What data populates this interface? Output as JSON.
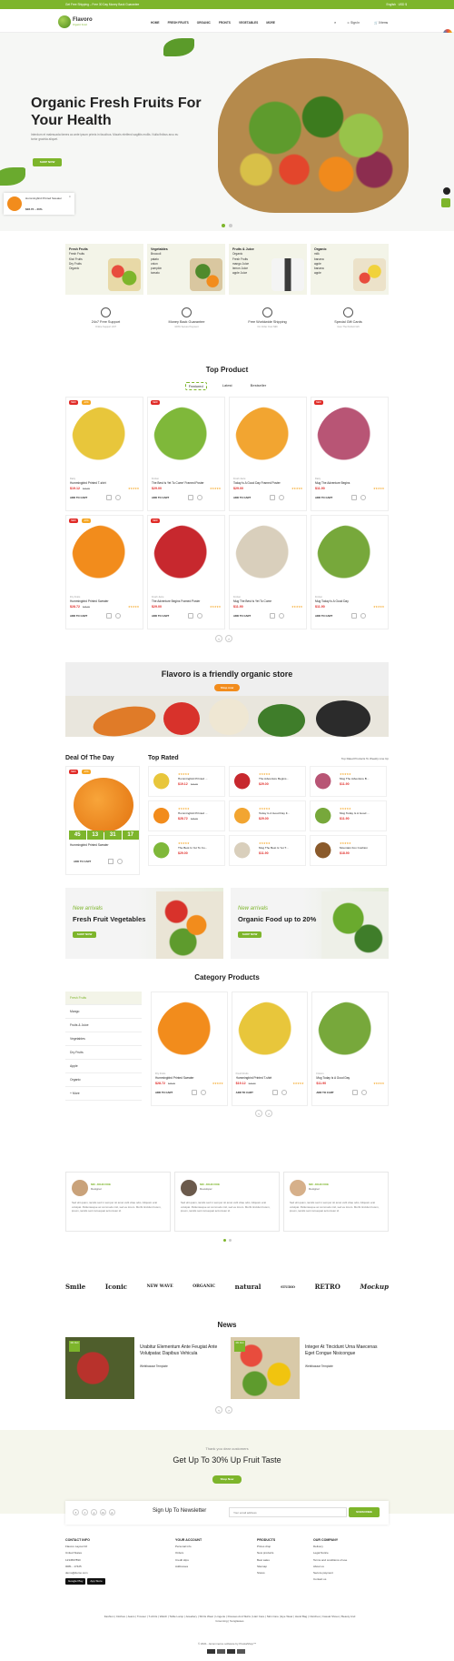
{
  "topbar": {
    "message": "Get Free Shipping – Free 30 Day Money Back Guarantee",
    "language": "English",
    "currency": "USD $"
  },
  "header": {
    "logo": "Flavoro",
    "tagline": "Organic Food",
    "nav": [
      "HOME",
      "FRESH FRUITS",
      "ORGANIC",
      "FRONTS",
      "VEGETABLES",
      "MORE"
    ],
    "signin": "Sign In",
    "cart": "0 items"
  },
  "hero": {
    "title": "Organic Fresh Fruits For Your Health",
    "subtitle": "Interdum et malesuada fames ac ante ipsum primis in faucibus. Mauris eleifend sagittis mollis. Nulla finibus arcu eu tortor gravida aliquet.",
    "button": "SHOP NOW"
  },
  "popup": {
    "name": "Hummingbird Printed Sweater",
    "price": "$28.72 – 20%"
  },
  "categories": [
    {
      "title": "Fresh Fruits",
      "items": [
        "Fresh Fruits",
        "Kiwi Fruits",
        "Dry Fruits",
        "Organic"
      ]
    },
    {
      "title": "Vegetables",
      "items": [
        "Broccoli",
        "patato",
        "onion",
        "pumpkin",
        "tomato"
      ]
    },
    {
      "title": "Fruits & Juice",
      "items": [
        "Organic",
        "Fresh Fruits",
        "mango Juice",
        "lemon Juice",
        "apple Juice"
      ]
    },
    {
      "title": "Organic",
      "items": [
        "milk",
        "banana",
        "apple",
        "banana",
        "apple"
      ]
    }
  ],
  "features": [
    {
      "title": "24x7 Free Support",
      "sub": "Online Support 24/7"
    },
    {
      "title": "Money Back Guarantee",
      "sub": "100% Secure Payment"
    },
    {
      "title": "Free Worldwide Shipping",
      "sub": "On Order Over $99"
    },
    {
      "title": "Special Gift Cards",
      "sub": "Give The Perfect Gift"
    }
  ],
  "top_product": {
    "title": "Top Product",
    "tabs": [
      "Featured",
      "Latest",
      "Bestseller"
    ]
  },
  "products": [
    {
      "cat": "Dairy",
      "name": "Hummingbird Printed T-shirt",
      "price": "$19.12",
      "old": "$23.90",
      "badges": [
        "NEW",
        "-20%"
      ],
      "color": "#e8c63b"
    },
    {
      "cat": "Frozen",
      "name": "The Best Is Yet To Come' Framed Poster",
      "price": "$29.00",
      "old": "",
      "badges": [
        "NEW"
      ],
      "color": "#7fb83a"
    },
    {
      "cat": "Fresh Juice",
      "name": "Today Is A Good Day Framed Poster",
      "price": "$29.00",
      "old": "",
      "badges": [],
      "color": "#f2a531"
    },
    {
      "cat": "Dairy",
      "name": "Mug The Adventure Begins",
      "price": "$11.90",
      "old": "",
      "badges": [
        "NEW"
      ],
      "color": "#b85575"
    },
    {
      "cat": "Dry Fruits",
      "name": "Hummingbird Printed Sweater",
      "price": "$28.72",
      "old": "$35.90",
      "badges": [
        "NEW",
        "-20%"
      ],
      "color": "#f28c1c"
    },
    {
      "cat": "Fresh Juice",
      "name": "The Adventure Begins Framed Poster",
      "price": "$29.00",
      "old": "",
      "badges": [
        "NEW"
      ],
      "color": "#c7282e"
    },
    {
      "cat": "Frozen",
      "name": "Mug The Best Is Yet To Come",
      "price": "$11.90",
      "old": "",
      "badges": [],
      "color": "#d9cfbc"
    },
    {
      "cat": "Frozen",
      "name": "Mug Today Is A Good Day",
      "price": "$11.90",
      "old": "",
      "badges": [],
      "color": "#77a83b"
    }
  ],
  "card_labels": {
    "add": "ADD TO CART",
    "stars": "★★★★★"
  },
  "store_banner": {
    "title": "Flavoro is a friendly organic store",
    "button": "Shop now"
  },
  "deal": {
    "title": "Deal Of The Day",
    "name": "Hummingbird Printed Sweater",
    "timer": [
      "45",
      "13",
      "31",
      "17"
    ],
    "badges": [
      "NEW",
      "-20%"
    ]
  },
  "top_rated": {
    "title": "Top Rated",
    "link": "Top Rated Products To Weekly Line Up",
    "items": [
      {
        "name": "Hummingbird Printed ...",
        "price": "$19.12",
        "old": "$23.90",
        "color": "#e8c63b"
      },
      {
        "name": "The Adventure Begins...",
        "price": "$29.00",
        "old": "",
        "color": "#c7282e"
      },
      {
        "name": "Mug The Adventure B...",
        "price": "$11.90",
        "old": "",
        "color": "#b85575"
      },
      {
        "name": "Hummingbird Printed ...",
        "price": "$28.72",
        "old": "$35.90",
        "color": "#f28c1c"
      },
      {
        "name": "Today Is A Good Day F...",
        "price": "$29.00",
        "old": "",
        "color": "#f2a531"
      },
      {
        "name": "Mug Today Is A Good ...",
        "price": "$11.90",
        "old": "",
        "color": "#77a83b"
      },
      {
        "name": "The Best Is Yet To Co...",
        "price": "$29.00",
        "old": "",
        "color": "#7fb83a"
      },
      {
        "name": "Mug The Best Is Yet T...",
        "price": "$11.90",
        "old": "",
        "color": "#d9cfbc"
      },
      {
        "name": "Mountain Fox Cushion",
        "price": "$18.90",
        "old": "",
        "color": "#8a5a2b"
      }
    ]
  },
  "promos": [
    {
      "tag": "New arrivals",
      "title": "Fresh Fruit Vegetables",
      "button": "SHOP NOW"
    },
    {
      "tag": "New arrivals",
      "title": "Organic Food up to 20%",
      "button": "SHOP NOW"
    }
  ],
  "category_products": {
    "title": "Category Products",
    "sidebar": [
      "Fresh Fruits",
      "Mango",
      "Fruits & Juice",
      "Vegetables",
      "Dry Fruits",
      "Apple",
      "Organic",
      "+ More"
    ],
    "items": [
      {
        "cat": "Dry Fruits",
        "name": "Hummingbird Printed Sweater",
        "price": "$28.72",
        "old": "$35.90",
        "color": "#f28c1c"
      },
      {
        "cat": "Fresh Fruits",
        "name": "Hummingbird Printed T-shirt",
        "price": "$19.12",
        "old": "$23.90",
        "color": "#e8c63b"
      },
      {
        "cat": "Frozen",
        "name": "Mug Today Is A Good Day",
        "price": "$11.90",
        "old": "",
        "color": "#77a83b"
      }
    ]
  },
  "testimonials": [
    {
      "name": "MR. JOHN DOE",
      "role": "Designer",
      "text": "Sed elit quam, iaculis sed in semper sit amet velit vitae odio. Aliquam erat volutpat. Pellentesque ac commodo nisl, sed eu lorem. Morbi tincidunt lorem, ipsum, iaculis sed consequat accumsan id."
    },
    {
      "name": "MR. JOHN DOE",
      "role": "Developer",
      "text": "Sed elit quam, iaculis sed in semper sit amet velit vitae odio. Aliquam erat volutpat. Pellentesque ac commodo nisl, sed eu lorem. Morbi tincidunt lorem, ipsum, iaculis sed consequat accumsan id."
    },
    {
      "name": "MR. JOHN DOE",
      "role": "Designer",
      "text": "Sed elit quam, iaculis sed in semper sit amet velit vitae odio. Aliquam erat volutpat. Pellentesque ac commodo nisl, sed eu lorem. Morbi tincidunt lorem, ipsum, iaculis sed consequat accumsan id."
    }
  ],
  "brands": [
    "Smile",
    "Iconic",
    "NEW WAVE",
    "ORGANIC",
    "natural",
    "STUDIO",
    "RETRO",
    "Mockup"
  ],
  "news": {
    "title": "News",
    "items": [
      {
        "date": "06 Oct",
        "title": "Urabitur Elementum Ante Feugiat Ante Volutpatac Dapibus Vehicula",
        "by": "Webibazaar Template"
      },
      {
        "date": "06 Oct",
        "title": "Integer At Tincidunt Urna Maecenas Eget Congue Nisicongue",
        "by": "Webibazaar Template"
      }
    ]
  },
  "offer": {
    "pre": "Thank you dear customers",
    "title": "Get Up To 30% Up Fruit Taste",
    "button": "Shop Now"
  },
  "newsletter": {
    "title": "Sign Up To Newsletter",
    "placeholder": "Your email address",
    "button": "SUBSCRIBE",
    "social": [
      "f",
      "t",
      "y",
      "in",
      "p"
    ]
  },
  "footer": {
    "contact": {
      "title": "CONTACT INFO",
      "lines": [
        "Flavoro Layout 02",
        "United States",
        "1234567890",
        "0081 - 17425",
        "demo@demo.com"
      ]
    },
    "account": {
      "title": "YOUR ACCOUNT",
      "items": [
        "Personal info",
        "Orders",
        "Credit slips",
        "Addresses"
      ]
    },
    "products": {
      "title": "PRODUCTS",
      "items": [
        "Prices drop",
        "New products",
        "Best sales",
        "Sitemap",
        "Stores"
      ]
    },
    "company": {
      "title": "OUR COMPANY",
      "items": [
        "Delivery",
        "Legal Notice",
        "Terms and conditions of use",
        "About us",
        "Secure payment",
        "Contact us"
      ]
    },
    "apps": [
      "Google Play",
      "App Store"
    ],
    "tags": "Fashion | Clothes | Jeans | Trouser | T-shirts | Watch | Table Lamp | Jewellery | Shirts Wear | Lingerie | Dresses And Skirts | Hair Care | Skin Care | Eye Wear | Hand Bag | Clutches | Casual Shoes | Beauty And Grooming | Sunglasses",
    "copyright": "© 2021 - Ecommerce software by PrestaShop™"
  },
  "colors": {
    "accent": "#7db52b",
    "price": "#e02b27",
    "star": "#f5a623"
  }
}
